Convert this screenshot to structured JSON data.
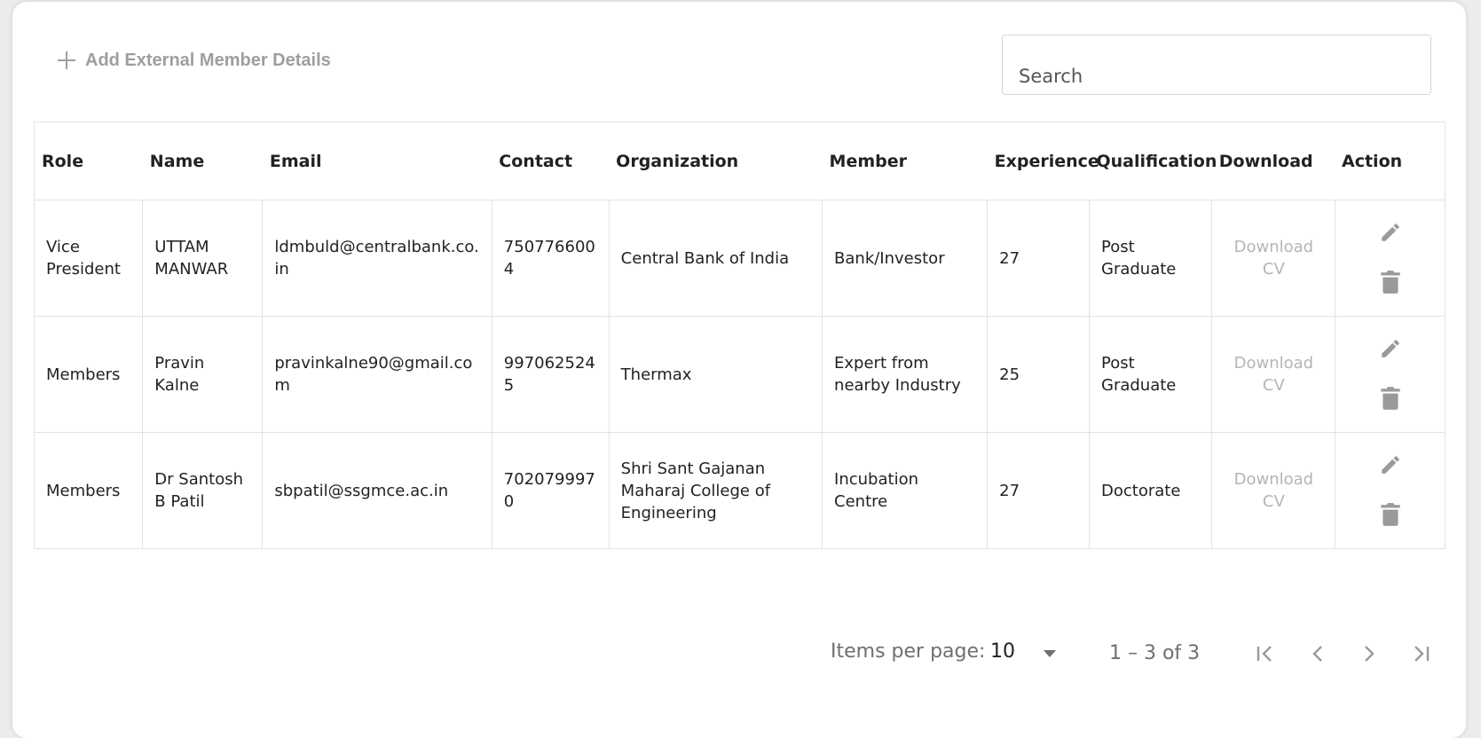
{
  "toolbar": {
    "add_label": "Add External Member Details",
    "search_placeholder": "Search"
  },
  "table": {
    "headers": [
      "Role",
      "Name",
      "Email",
      "Contact",
      "Organization",
      "Member",
      "Experience",
      "Qualification",
      "Download",
      "Action"
    ],
    "rows": [
      {
        "role": "Vice President",
        "name": "UTTAM MANWAR",
        "email": "ldmbuld@centralbank.co.in",
        "contact": "7507766004",
        "organization": "Central Bank of India",
        "member": "Bank/Investor",
        "experience": "27",
        "qualification": "Post Graduate",
        "download": "Download CV"
      },
      {
        "role": "Members",
        "name": "Pravin Kalne",
        "email": "pravinkalne90@gmail.com",
        "contact": "9970625245",
        "organization": "Thermax",
        "member": "Expert from nearby Industry",
        "experience": "25",
        "qualification": "Post Graduate",
        "download": "Download CV"
      },
      {
        "role": "Members",
        "name": "Dr Santosh B Patil",
        "email": "sbpatil@ssgmce.ac.in",
        "contact": "7020799970",
        "organization": "Shri Sant Gajanan Maharaj College of Engineering",
        "member": "Incubation Centre",
        "experience": "27",
        "qualification": "Doctorate",
        "download": "Download CV"
      }
    ]
  },
  "pagination": {
    "items_per_page_label": "Items per page:",
    "items_per_page_value": "10",
    "range_label": "1 – 3 of 3"
  },
  "icons": {
    "add": "plus-icon",
    "edit": "pencil-icon",
    "delete": "trash-icon",
    "dropdown": "caret-down-icon",
    "first": "first-page-icon",
    "prev": "chevron-left-icon",
    "next": "chevron-right-icon",
    "last": "last-page-icon"
  },
  "colors": {
    "muted_text": "#9e9e9e",
    "icon_gray": "#9a9a9a",
    "border": "#e3e3e3"
  }
}
